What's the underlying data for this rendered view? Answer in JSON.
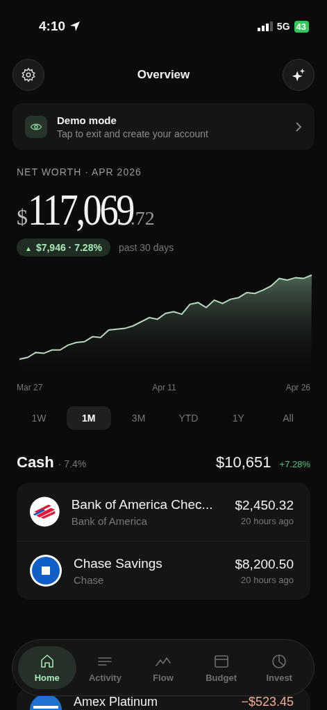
{
  "status_bar": {
    "time": "4:10",
    "network": "5G",
    "battery": "43"
  },
  "header": {
    "title": "Overview"
  },
  "demo_banner": {
    "title": "Demo mode",
    "subtitle": "Tap to exit and create your account"
  },
  "net_worth": {
    "label": "NET WORTH · APR 2026",
    "currency": "$",
    "whole": "117,069",
    "cents": ".72",
    "change": "$7,946 · 7.28%",
    "change_arrow": "▲",
    "period": "past 30 days"
  },
  "chart": {
    "x_labels": [
      "Mar 27",
      "Apr 11",
      "Apr 26"
    ]
  },
  "ranges": [
    {
      "label": "1W",
      "selected": false
    },
    {
      "label": "1M",
      "selected": true
    },
    {
      "label": "3M",
      "selected": false
    },
    {
      "label": "YTD",
      "selected": false
    },
    {
      "label": "1Y",
      "selected": false
    },
    {
      "label": "All",
      "selected": false
    }
  ],
  "cash": {
    "title": "Cash",
    "share": "· 7.4%",
    "total": "$10,651",
    "change": "+7.28%"
  },
  "accounts": [
    {
      "kind": "boa",
      "name": "Bank of America Chec...",
      "institution": "Bank of America",
      "amount": "$2,450.32",
      "updated": "20 hours ago"
    },
    {
      "kind": "chase",
      "name": "Chase Savings",
      "institution": "Chase",
      "amount": "$8,200.50",
      "updated": "20 hours ago"
    }
  ],
  "next_account": {
    "name": "Amex Platinum",
    "amount": "−$523.45"
  },
  "nav": [
    {
      "kind": "home",
      "label": "Home",
      "selected": true
    },
    {
      "kind": "activity",
      "label": "Activity",
      "selected": false
    },
    {
      "kind": "flow",
      "label": "Flow",
      "selected": false
    },
    {
      "kind": "budget",
      "label": "Budget",
      "selected": false
    },
    {
      "kind": "invest",
      "label": "Invest",
      "selected": false
    }
  ]
}
